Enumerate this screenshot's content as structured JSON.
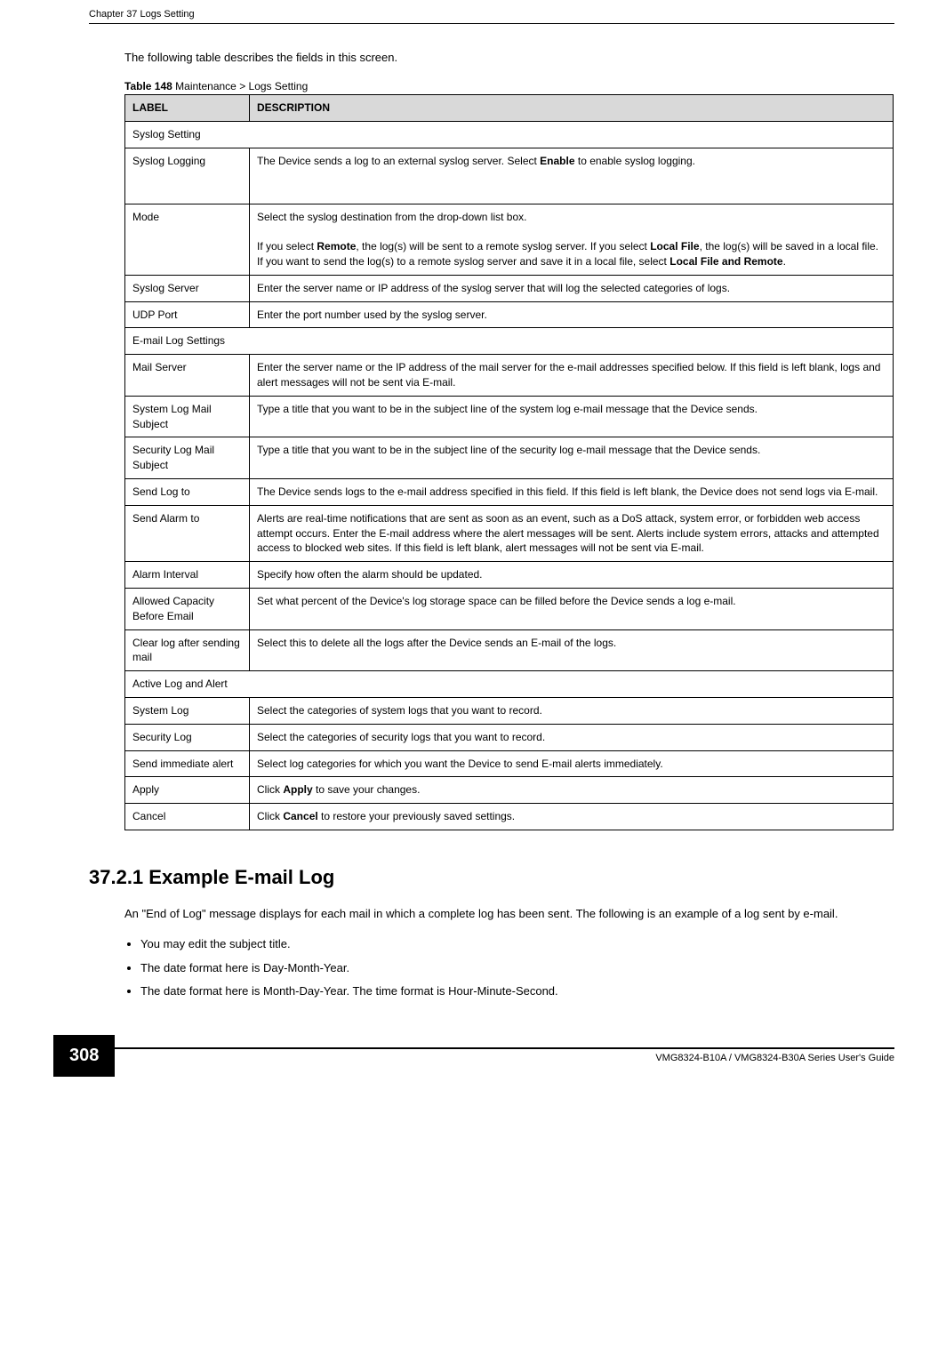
{
  "running_head": "Chapter 37 Logs Setting",
  "intro": "The following table describes the fields in this screen.",
  "table_caption_prefix": "Table 148",
  "table_caption_rest": "   Maintenance >  Logs Setting",
  "columns": {
    "label": "LABEL",
    "desc": "DESCRIPTION"
  },
  "rows": [
    {
      "type": "section",
      "label": "Syslog Setting"
    },
    {
      "type": "row",
      "label": "Syslog Logging",
      "desc_html": "The Device sends a log to an external syslog server. Select <b>Enable</b> to enable syslog logging.",
      "tall": true
    },
    {
      "type": "row",
      "label": "Mode",
      "desc_html": "Select the syslog destination from the drop-down list box.<br><br>If you select <b>Remote</b>, the log(s) will be sent to a remote syslog server. If you select <b>Local File</b>, the log(s) will be saved in a local file. If you want to send the log(s) to a remote syslog server and save it in a local file, select <b>Local File and Remote</b>."
    },
    {
      "type": "row",
      "label": "Syslog Server",
      "desc_html": "Enter the server name or IP address of the syslog server that will log the selected categories of logs."
    },
    {
      "type": "row",
      "label": "UDP Port",
      "desc_html": "Enter the port number used by the syslog server."
    },
    {
      "type": "section",
      "label": "E-mail Log Settings"
    },
    {
      "type": "row",
      "label": "Mail Server",
      "desc_html": "Enter the server name or the IP address of the mail server for the e-mail addresses specified below. If this field is left blank, logs and alert messages will not be sent via E-mail."
    },
    {
      "type": "row",
      "label": "System Log Mail Subject",
      "desc_html": "Type a title that you want to be in the subject line of the system log e-mail message that the Device sends."
    },
    {
      "type": "row",
      "label": "Security Log Mail Subject",
      "desc_html": "Type a title that you want to be in the subject line of the security log e-mail message that the Device sends."
    },
    {
      "type": "row",
      "label": "Send Log to",
      "desc_html": "The Device sends logs to the e-mail address specified in this field. If this field is left blank, the Device does not send logs via E-mail."
    },
    {
      "type": "row",
      "label": "Send Alarm to",
      "desc_html": "Alerts are real-time notifications that are sent as soon as an event, such as a DoS attack, system error, or forbidden web access attempt occurs. Enter the E-mail address where the alert messages will be sent. Alerts include system errors, attacks and attempted access to blocked web sites. If this field is left blank, alert messages will not be sent via E-mail."
    },
    {
      "type": "row",
      "label": "Alarm Interval",
      "desc_html": "Specify how often the alarm should be updated."
    },
    {
      "type": "row",
      "label": "Allowed Capacity Before Email",
      "desc_html": "Set what percent of the Device's log storage space can be filled before the Device sends a log e-mail."
    },
    {
      "type": "row",
      "label": "Clear log after sending mail",
      "desc_html": "Select this to delete all the logs after the Device sends an E-mail of the logs."
    },
    {
      "type": "section",
      "label": "Active Log and Alert"
    },
    {
      "type": "row",
      "label": "System Log",
      "desc_html": "Select the categories of system logs that you want to record."
    },
    {
      "type": "row",
      "label": "Security Log",
      "desc_html": "Select the categories of security logs that you want to record."
    },
    {
      "type": "row",
      "label": "Send immediate alert",
      "desc_html": "Select log categories for which you want the Device to send E-mail alerts immediately."
    },
    {
      "type": "row",
      "label": "Apply",
      "desc_html": "Click <b>Apply</b> to save your changes."
    },
    {
      "type": "row",
      "label": "Cancel",
      "desc_html": "Click <b>Cancel</b> to restore your previously saved settings."
    }
  ],
  "section_heading": "37.2.1  Example E-mail Log",
  "section_body": "An \"End of Log\" message displays for each mail in which a complete log has been sent. The following is an example of a log sent by e-mail.",
  "bullets": [
    "You may edit the subject title.",
    "The date format here is Day-Month-Year.",
    "The date format here is Month-Day-Year. The time format is Hour-Minute-Second."
  ],
  "page_number": "308",
  "footer_text": "VMG8324-B10A / VMG8324-B30A Series User's Guide"
}
